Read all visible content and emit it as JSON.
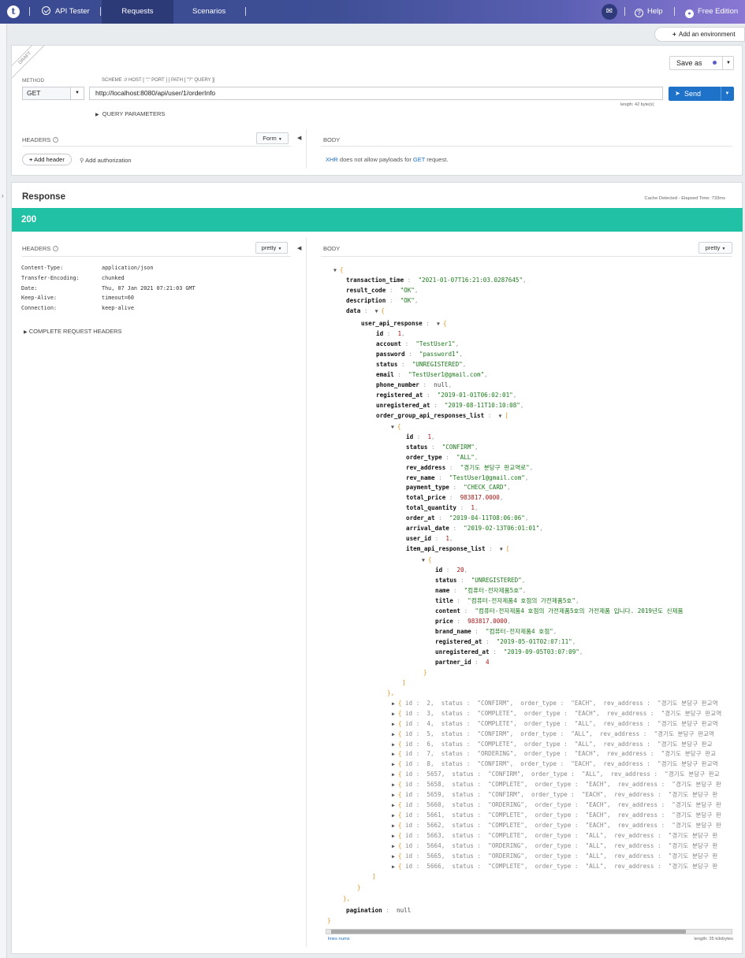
{
  "topbar": {
    "logo": "t",
    "app_name": "API Tester",
    "tabs": [
      "Requests",
      "Scenarios"
    ],
    "help": "Help",
    "edition": "Free Edition"
  },
  "environment": {
    "add_label": "Add an environment"
  },
  "request": {
    "badge": "DRAFT",
    "save_label": "Save as",
    "method_label": "METHOD",
    "method": "GET",
    "scheme_hint": "SCHEME :// HOST [ \":\" PORT ] [ PATH [ \"?\" QUERY ]]",
    "url": "http://localhost:8080/api/user/1/orderInfo",
    "url_length": "length: 42 byte(s)",
    "send_label": "Send",
    "query_params": "QUERY PARAMETERS",
    "headers_title": "HEADERS",
    "headers_mode": "Form",
    "add_header": "Add header",
    "add_authorization": "Add authorization",
    "body_title": "BODY",
    "body_note": {
      "xhr": "XHR",
      "mid": " does not allow payloads for ",
      "get": "GET",
      "end": " request."
    }
  },
  "response": {
    "title": "Response",
    "meta": "Cache Detected - Elapsed Time: 733ms",
    "status": "200",
    "headers_title": "HEADERS",
    "headers_mode": "pretty",
    "headers": [
      {
        "name": "Content-Type:",
        "value": "application/json"
      },
      {
        "name": "Transfer-Encoding:",
        "value": "chunked"
      },
      {
        "name": "Date:",
        "value": "Thu, 07 Jan 2021 07:21:03 GMT"
      },
      {
        "name": "Keep-Alive:",
        "value": "timeout=60"
      },
      {
        "name": "Connection:",
        "value": "keep-alive"
      }
    ],
    "complete_headers": "COMPLETE REQUEST HEADERS",
    "body_title": "BODY",
    "body_mode": "pretty",
    "footer_left": "lines nums",
    "footer_right": "length: 35 kilobytes"
  },
  "json_body": {
    "transaction_time": "\"2021-01-07T16:21:03.0287645\"",
    "result_code": "\"OK\"",
    "description": "\"OK\"",
    "user": {
      "id": "1",
      "account": "\"TestUser1\"",
      "password": "\"password1\"",
      "status": "\"UNREGISTERED\"",
      "email": "\"TestUser1@gmail.com\"",
      "phone_number": "null",
      "registered_at": "\"2019-01-01T06:02:01\"",
      "unregistered_at": "\"2019-08-11T10:10:08\""
    },
    "order": {
      "id": "1",
      "status": "\"CONFIRM\"",
      "order_type": "\"ALL\"",
      "rev_address": "\"경기도 분당구 판교역로\"",
      "rev_name": "\"TestUser1@gmail.com\"",
      "payment_type": "\"CHECK_CARD\"",
      "total_price": "983817.0000",
      "total_quantity": "1",
      "order_at": "\"2019-04-11T08:06:06\"",
      "arrival_date": "\"2019-02-13T06:01:01\"",
      "user_id": "1"
    },
    "item": {
      "id": "20",
      "status": "\"UNREGISTERED\"",
      "name": "\"컴퓨터-전자제품5호\"",
      "title": "\"컴퓨터-전자제품4 호점의 가전제품5호\"",
      "content": "\"컴퓨터-전자제품4 호점의 가전제품5호의 가전제품 입니다. 2019년도 신제품",
      "price": "983817.0000",
      "brand_name": "\"컴퓨터-전자제품4 호점\"",
      "registered_at": "\"2019-05-01T02:07:11\"",
      "unregistered_at": "\"2019-09-05T03:07:09\"",
      "partner_id": "4"
    },
    "collapsed_orders": [
      {
        "id": "2",
        "status": "\"CONFIRM\"",
        "order_type": "\"EACH\"",
        "rev_address": "\"경기도 분당구 판교역"
      },
      {
        "id": "3",
        "status": "\"COMPLETE\"",
        "order_type": "\"EACH\"",
        "rev_address": "\"경기도 분당구 판교역"
      },
      {
        "id": "4",
        "status": "\"COMPLETE\"",
        "order_type": "\"ALL\"",
        "rev_address": "\"경기도 분당구 판교역"
      },
      {
        "id": "5",
        "status": "\"CONFIRM\"",
        "order_type": "\"ALL\"",
        "rev_address": "\"경기도 분당구 판교역"
      },
      {
        "id": "6",
        "status": "\"COMPLETE\"",
        "order_type": "\"ALL\"",
        "rev_address": "\"경기도 분당구 판교"
      },
      {
        "id": "7",
        "status": "\"ORDERING\"",
        "order_type": "\"EACH\"",
        "rev_address": "\"경기도 분당구 판교"
      },
      {
        "id": "8",
        "status": "\"CONFIRM\"",
        "order_type": "\"EACH\"",
        "rev_address": "\"경기도 분당구 판교역"
      },
      {
        "id": "5657",
        "status": "\"CONFIRM\"",
        "order_type": "\"ALL\"",
        "rev_address": "\"경기도 분당구 판교"
      },
      {
        "id": "5658",
        "status": "\"COMPLETE\"",
        "order_type": "\"EACH\"",
        "rev_address": "\"경기도 분당구 판"
      },
      {
        "id": "5659",
        "status": "\"CONFIRM\"",
        "order_type": "\"EACH\"",
        "rev_address": "\"경기도 분당구 판"
      },
      {
        "id": "5660",
        "status": "\"ORDERING\"",
        "order_type": "\"EACH\"",
        "rev_address": "\"경기도 분당구 판"
      },
      {
        "id": "5661",
        "status": "\"COMPLETE\"",
        "order_type": "\"EACH\"",
        "rev_address": "\"경기도 분당구 판"
      },
      {
        "id": "5662",
        "status": "\"COMPLETE\"",
        "order_type": "\"EACH\"",
        "rev_address": "\"경기도 분당구 판"
      },
      {
        "id": "5663",
        "status": "\"COMPLETE\"",
        "order_type": "\"ALL\"",
        "rev_address": "\"경기도 분당구 판"
      },
      {
        "id": "5664",
        "status": "\"ORDERING\"",
        "order_type": "\"ALL\"",
        "rev_address": "\"경기도 분당구 판"
      },
      {
        "id": "5665",
        "status": "\"ORDERING\"",
        "order_type": "\"ALL\"",
        "rev_address": "\"경기도 분당구 판"
      },
      {
        "id": "5666",
        "status": "\"COMPLETE\"",
        "order_type": "\"ALL\"",
        "rev_address": "\"경기도 분당구 판"
      }
    ],
    "pagination": "null"
  },
  "colors": {
    "brand": "#3a4a92",
    "accent": "#21c1a5",
    "send": "#1e73c9"
  },
  "icons": [
    "logo-icon",
    "check-circle-icon",
    "chat-icon",
    "help-icon",
    "user-icon",
    "plus-icon",
    "key-icon",
    "send-icon",
    "info-icon",
    "caret-down-icon",
    "caret-right-icon",
    "caret-left-icon"
  ]
}
